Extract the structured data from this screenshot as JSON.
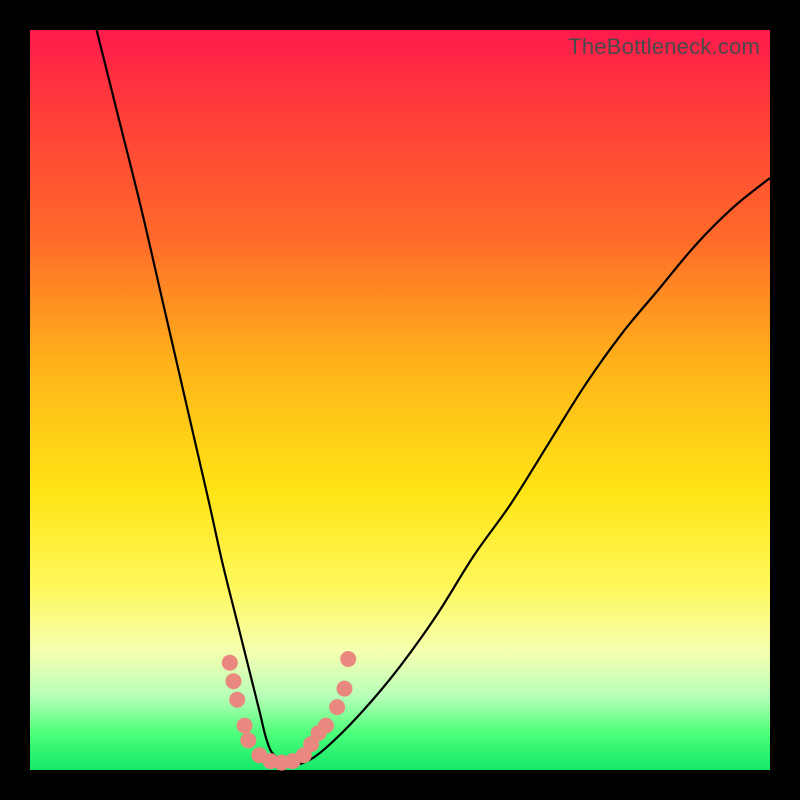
{
  "watermark": {
    "text": "TheBottleneck.com"
  },
  "colors": {
    "background": "#000000",
    "curve": "#000000",
    "dot": "#e9887f",
    "gradient_top": "#ff1a4d",
    "gradient_bottom": "#14e86a"
  },
  "chart_data": {
    "type": "line",
    "title": "",
    "xlabel": "",
    "ylabel": "",
    "xlim": [
      0,
      100
    ],
    "ylim": [
      0,
      100
    ],
    "grid": false,
    "legend": false,
    "annotations": [
      "TheBottleneck.com"
    ],
    "series": [
      {
        "name": "bottleneck-curve",
        "x": [
          9,
          12,
          15,
          18,
          21,
          24,
          26,
          28,
          30,
          31,
          32,
          33,
          35,
          37,
          40,
          45,
          50,
          55,
          60,
          65,
          70,
          75,
          80,
          85,
          90,
          95,
          100
        ],
        "y": [
          100,
          88,
          76,
          63,
          50,
          37,
          28,
          20,
          12,
          8,
          4,
          2,
          1,
          1,
          3,
          8,
          14,
          21,
          29,
          36,
          44,
          52,
          59,
          65,
          71,
          76,
          80
        ]
      }
    ],
    "dots": [
      {
        "x": 27.0,
        "y": 14.5
      },
      {
        "x": 27.5,
        "y": 12.0
      },
      {
        "x": 28.0,
        "y": 9.5
      },
      {
        "x": 29.0,
        "y": 6.0
      },
      {
        "x": 29.5,
        "y": 4.0
      },
      {
        "x": 31.0,
        "y": 2.0
      },
      {
        "x": 32.5,
        "y": 1.2
      },
      {
        "x": 34.0,
        "y": 1.0
      },
      {
        "x": 35.5,
        "y": 1.2
      },
      {
        "x": 37.0,
        "y": 2.0
      },
      {
        "x": 38.0,
        "y": 3.5
      },
      {
        "x": 39.0,
        "y": 5.0
      },
      {
        "x": 40.0,
        "y": 6.0
      },
      {
        "x": 41.5,
        "y": 8.5
      },
      {
        "x": 42.5,
        "y": 11.0
      },
      {
        "x": 43.0,
        "y": 15.0
      }
    ]
  }
}
